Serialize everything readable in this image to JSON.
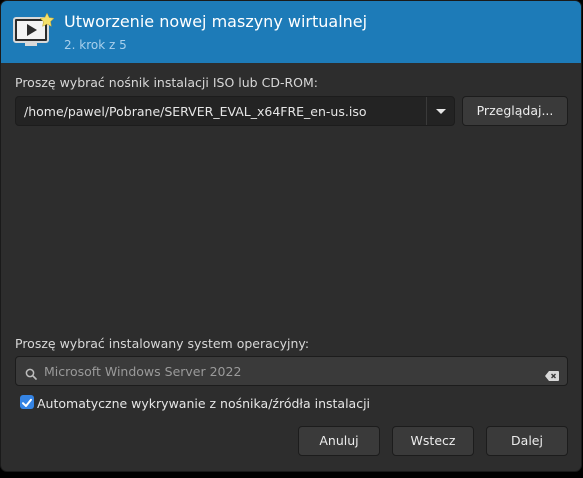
{
  "header": {
    "title": "Utworzenie nowej maszyny wirtualnej",
    "subtitle": "2. krok z 5",
    "icon": "computer-with-star-icon"
  },
  "iso": {
    "label": "Proszę wybrać nośnik instalacji ISO lub CD-ROM:",
    "path": "/home/pawel/Pobrane/SERVER_EVAL_x64FRE_en-us.iso",
    "browse_label": "Przeglądaj..."
  },
  "os": {
    "label": "Proszę wybrać instalowany system operacyjny:",
    "value": "Microsoft Windows Server 2022",
    "autodetect_label": "Automatyczne wykrywanie z nośnika/źródła instalacji",
    "autodetect_checked": true
  },
  "buttons": {
    "cancel": "Anuluj",
    "back": "Wstecz",
    "forward": "Dalej"
  },
  "colors": {
    "header_bg": "#1d7bb8",
    "dialog_bg": "#2d2d2d",
    "accent": "#3584e4"
  }
}
